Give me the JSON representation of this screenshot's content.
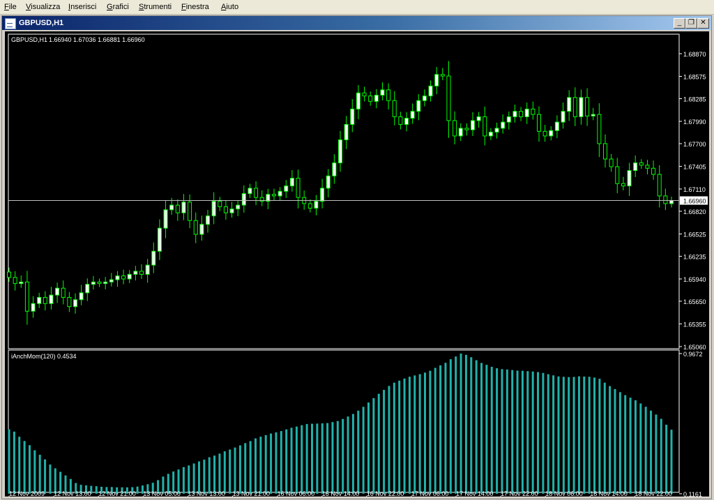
{
  "menu": {
    "items": [
      {
        "label": "File",
        "key": "F",
        "rest": "ile"
      },
      {
        "label": "Visualizza",
        "key": "V",
        "rest": "isualizza"
      },
      {
        "label": "Inserisci",
        "key": "I",
        "rest": "nserisci"
      },
      {
        "label": "Grafici",
        "key": "G",
        "rest": "rafici"
      },
      {
        "label": "Strumenti",
        "key": "S",
        "rest": "trumenti"
      },
      {
        "label": "Finestra",
        "key": "F",
        "rest": "inestra"
      },
      {
        "label": "Aiuto",
        "key": "A",
        "rest": "iuto"
      }
    ]
  },
  "window": {
    "title": "GBPUSD,H1",
    "minimize_glyph": "_",
    "restore_glyph": "❐",
    "close_glyph": "✕"
  },
  "colors": {
    "background": "#000000",
    "bull_candle": "#ffffff",
    "bear_candle": "#000000",
    "wick": "#00ff00",
    "histogram": "#20b2aa",
    "text": "#ffffff",
    "bid_line": "#c0c0c0"
  },
  "chart_data": [
    {
      "type": "candlestick",
      "title": "GBPUSD,H1",
      "ohlc_text": "1.66940 1.67036 1.66881 1.66960",
      "ylim": [
        1.6506,
        1.6887
      ],
      "y_ticks": [
        "1.68870",
        "1.68575",
        "1.68285",
        "1.67990",
        "1.67700",
        "1.67405",
        "1.67110",
        "1.66820",
        "1.66525",
        "1.66235",
        "1.65940",
        "1.65650",
        "1.65355",
        "1.65060"
      ],
      "current_price": "1.66960",
      "closes": [
        1.6596,
        1.6588,
        1.659,
        1.6552,
        1.6562,
        1.657,
        1.6562,
        1.6573,
        1.6582,
        1.657,
        1.6558,
        1.6567,
        1.6576,
        1.6587,
        1.659,
        1.6588,
        1.659,
        1.6593,
        1.6598,
        1.6594,
        1.66,
        1.6604,
        1.66,
        1.6612,
        1.663,
        1.666,
        1.6684,
        1.669,
        1.668,
        1.6694,
        1.667,
        1.6652,
        1.6665,
        1.6676,
        1.6695,
        1.6688,
        1.668,
        1.6685,
        1.669,
        1.6705,
        1.6712,
        1.67,
        1.6695,
        1.6704,
        1.6702,
        1.6708,
        1.6715,
        1.6725,
        1.67,
        1.6692,
        1.6686,
        1.6695,
        1.6712,
        1.6728,
        1.6745,
        1.6775,
        1.6795,
        1.6815,
        1.6836,
        1.6832,
        1.6825,
        1.6833,
        1.684,
        1.6826,
        1.6805,
        1.6795,
        1.6803,
        1.6812,
        1.6826,
        1.6832,
        1.6845,
        1.686,
        1.6858,
        1.68,
        1.678,
        1.679,
        1.6788,
        1.68,
        1.6805,
        1.678,
        1.6785,
        1.679,
        1.6798,
        1.6805,
        1.6812,
        1.6805,
        1.6815,
        1.6808,
        1.6786,
        1.678,
        1.6787,
        1.6798,
        1.6812,
        1.683,
        1.6805,
        1.683,
        1.6806,
        1.6808,
        1.677,
        1.675,
        1.674,
        1.6718,
        1.6715,
        1.6735,
        1.6745,
        1.6742,
        1.6738,
        1.673,
        1.6702,
        1.6692,
        1.6696
      ]
    },
    {
      "type": "bar",
      "title": "iAnchMom(120) 0.4534",
      "ylim": [
        0.1161,
        0.9672
      ],
      "y_ticks": [
        "0.9672",
        "0.1161"
      ],
      "values": [
        0.5074,
        0.4933,
        0.4622,
        0.4364,
        0.411,
        0.3801,
        0.3527,
        0.3246,
        0.2934,
        0.2704,
        0.2492,
        0.2271,
        0.2057,
        0.181,
        0.1703,
        0.1669,
        0.164,
        0.1621,
        0.1586,
        0.1568,
        0.1568,
        0.155,
        0.1549,
        0.155,
        0.156,
        0.1596,
        0.1663,
        0.1736,
        0.1827,
        0.1987,
        0.2203,
        0.2369,
        0.251,
        0.2634,
        0.2778,
        0.2878,
        0.2998,
        0.3122,
        0.323,
        0.3378,
        0.3476,
        0.3595,
        0.3736,
        0.3844,
        0.3968,
        0.4099,
        0.4236,
        0.436,
        0.4521,
        0.4627,
        0.472,
        0.4817,
        0.4886,
        0.4966,
        0.5067,
        0.5166,
        0.5241,
        0.5322,
        0.5392,
        0.541,
        0.542,
        0.5434,
        0.5452,
        0.5514,
        0.5576,
        0.5701,
        0.5851,
        0.6004,
        0.6206,
        0.6439,
        0.6701,
        0.6967,
        0.7229,
        0.7467,
        0.7708,
        0.7905,
        0.8026,
        0.8155,
        0.8266,
        0.8343,
        0.842,
        0.8516,
        0.8626,
        0.8805,
        0.8959,
        0.9111,
        0.9329,
        0.9494,
        0.9672,
        0.9594,
        0.945,
        0.9268,
        0.9104,
        0.899,
        0.8867,
        0.8781,
        0.8729,
        0.8705,
        0.8672,
        0.8637,
        0.8627,
        0.8605,
        0.8581,
        0.8547,
        0.8495,
        0.8418,
        0.8348,
        0.8283,
        0.826,
        0.8245,
        0.8255,
        0.829,
        0.8276,
        0.8262,
        0.8214,
        0.8141,
        0.7904,
        0.7697,
        0.7516,
        0.7328,
        0.7146,
        0.6994,
        0.6836,
        0.6642,
        0.6442,
        0.6208,
        0.5969,
        0.5711,
        0.5352,
        0.5051
      ]
    }
  ],
  "time_labels": [
    "12 Nov 2009",
    "12 Nov 13:00",
    "12 Nov 21:00",
    "13 Nov 05:00",
    "13 Nov 13:00",
    "13 Nov 21:00",
    "16 Nov 06:00",
    "16 Nov 14:00",
    "16 Nov 22:00",
    "17 Nov 06:00",
    "17 Nov 14:00",
    "17 Nov 22:00",
    "18 Nov 06:00",
    "18 Nov 14:00",
    "18 Nov 22:00"
  ]
}
